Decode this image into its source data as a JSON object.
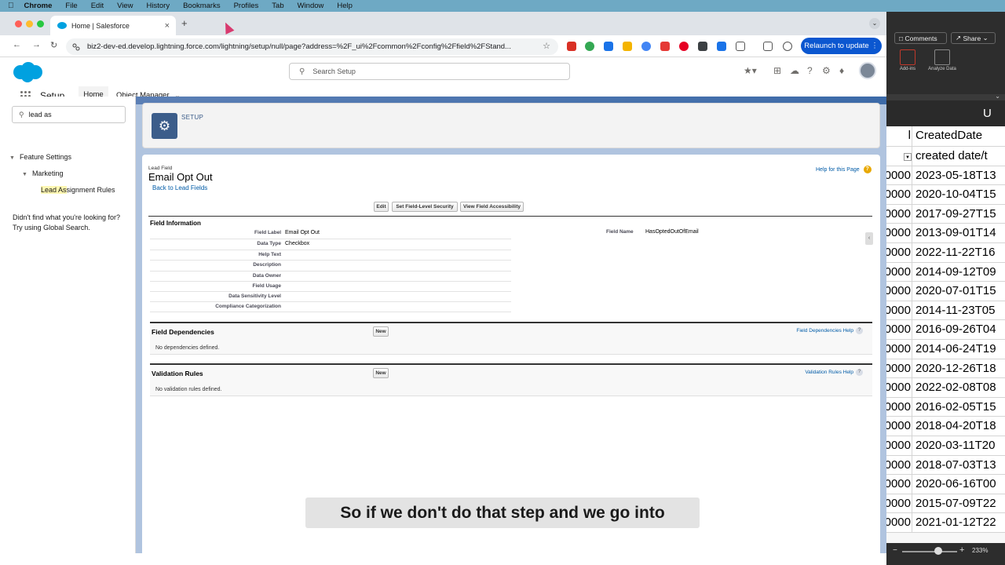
{
  "menubar": {
    "app": "Chrome",
    "items": [
      "File",
      "Edit",
      "View",
      "History",
      "Bookmarks",
      "Profiles",
      "Tab",
      "Window",
      "Help"
    ]
  },
  "browser": {
    "tab_title": "Home | Salesforce",
    "url": "biz2-dev-ed.develop.lightning.force.com/lightning/setup/null/page?address=%2F_ui%2Fcommon%2Fconfig%2Ffield%2FStand...",
    "relaunch_label": "Relaunch to update"
  },
  "sf": {
    "search_placeholder": "Search Setup",
    "app_label": "Setup",
    "nav_home": "Home",
    "nav_object_manager": "Object Manager",
    "quick_find_value": "lead as",
    "tree": {
      "feature_settings": "Feature Settings",
      "marketing": "Marketing",
      "lead_assignment_hl": "Lead As",
      "lead_assignment_rest": "signment Rules"
    },
    "not_found_line1": "Didn't find what you're looking for?",
    "not_found_line2": "Try using Global Search.",
    "setup_crumb": "SETUP"
  },
  "detail": {
    "object_label": "Lead Field",
    "title": "Email Opt Out",
    "back_link": "Back to Lead Fields",
    "help_link": "Help for this Page",
    "buttons": {
      "edit": "Edit",
      "fls": "Set Field-Level Security",
      "access": "View Field Accessibility"
    },
    "section_info": "Field Information",
    "fields": [
      {
        "label": "Field Label",
        "value": "Email Opt Out"
      },
      {
        "label": "Data Type",
        "value": "Checkbox"
      },
      {
        "label": "Help Text",
        "value": ""
      },
      {
        "label": "Description",
        "value": ""
      },
      {
        "label": "Data Owner",
        "value": ""
      },
      {
        "label": "Field Usage",
        "value": ""
      },
      {
        "label": "Data Sensitivity Level",
        "value": ""
      },
      {
        "label": "Compliance Categorization",
        "value": ""
      }
    ],
    "field_name_label": "Field Name",
    "field_name_value": "HasOptedOutOfEmail",
    "dependencies": {
      "title": "Field Dependencies",
      "new": "New",
      "help": "Field Dependencies Help",
      "empty": "No dependencies defined."
    },
    "validation": {
      "title": "Validation Rules",
      "new": "New",
      "help": "Validation Rules Help",
      "empty": "No validation rules defined."
    }
  },
  "caption": "So if we don't do that step and we go into",
  "sheet": {
    "comments": "Comments",
    "share": "Share",
    "addins": "Add-ins",
    "analyze": "Analyze Data",
    "col_letter": "U",
    "header_row": {
      "c1": "l",
      "c2": "CreatedDate"
    },
    "sub_row": {
      "c1": "",
      "c2": "created date/t"
    },
    "rows": [
      {
        "c1": "0000",
        "c2": "2023-05-18T13"
      },
      {
        "c1": "0000",
        "c2": "2020-10-04T15"
      },
      {
        "c1": "0000",
        "c2": "2017-09-27T15"
      },
      {
        "c1": "0000",
        "c2": "2013-09-01T14"
      },
      {
        "c1": "0000",
        "c2": "2022-11-22T16"
      },
      {
        "c1": "0000",
        "c2": "2014-09-12T09"
      },
      {
        "c1": "0000",
        "c2": "2020-07-01T15"
      },
      {
        "c1": "0000",
        "c2": "2014-11-23T05"
      },
      {
        "c1": "0000",
        "c2": "2016-09-26T04"
      },
      {
        "c1": "0000",
        "c2": "2014-06-24T19"
      },
      {
        "c1": "0000",
        "c2": "2020-12-26T18"
      },
      {
        "c1": "0000",
        "c2": "2022-02-08T08"
      },
      {
        "c1": "0000",
        "c2": "2016-02-05T15"
      },
      {
        "c1": "0000",
        "c2": "2018-04-20T18"
      },
      {
        "c1": "0000",
        "c2": "2020-03-11T20"
      },
      {
        "c1": "0000",
        "c2": "2018-07-03T13"
      },
      {
        "c1": "0000",
        "c2": "2020-06-16T00"
      },
      {
        "c1": "0000",
        "c2": "2015-07-09T22"
      },
      {
        "c1": "0000",
        "c2": "2021-01-12T22"
      }
    ],
    "zoom": "233%"
  }
}
